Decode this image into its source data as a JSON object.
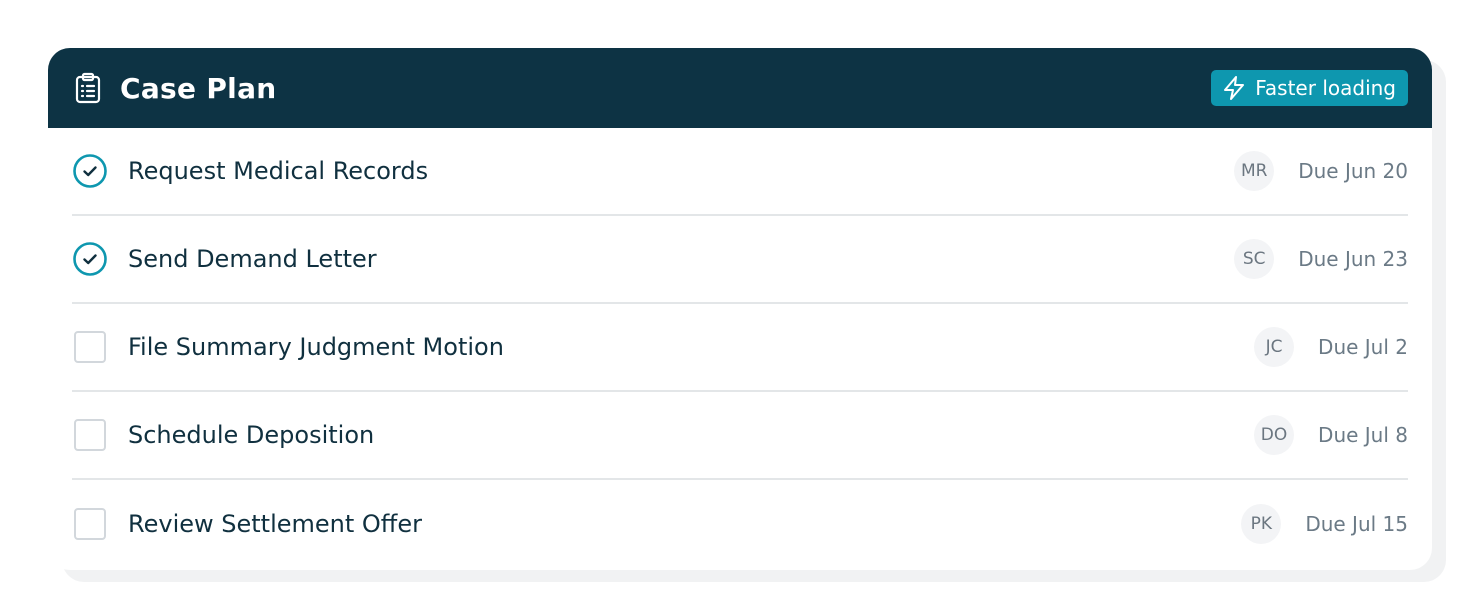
{
  "header": {
    "icon": "clipboard-list-icon",
    "title": "Case Plan",
    "badge": {
      "icon": "lightning-icon",
      "label": "Faster loading"
    }
  },
  "colors": {
    "header_bg": "#0d3344",
    "accent": "#0e97af",
    "divider": "#e3e6e8"
  },
  "tasks": [
    {
      "label": "Request Medical Records",
      "completed": true,
      "assignee": "MR",
      "due": "Due Jun 20"
    },
    {
      "label": "Send Demand Letter",
      "completed": true,
      "assignee": "SC",
      "due": "Due Jun 23"
    },
    {
      "label": "File Summary Judgment Motion",
      "completed": false,
      "assignee": "JC",
      "due": "Due Jul 2"
    },
    {
      "label": "Schedule Deposition",
      "completed": false,
      "assignee": "DO",
      "due": "Due Jul 8"
    },
    {
      "label": "Review Settlement Offer",
      "completed": false,
      "assignee": "PK",
      "due": "Due Jul 15"
    }
  ]
}
